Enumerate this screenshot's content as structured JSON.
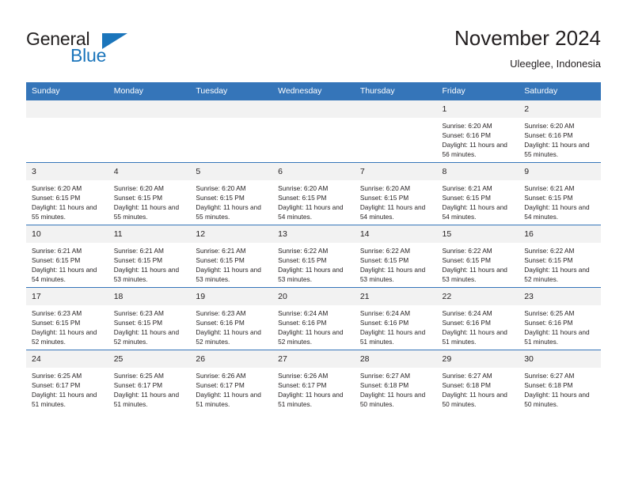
{
  "brand": {
    "name_part1": "General",
    "name_part2": "Blue"
  },
  "header": {
    "month_title": "November 2024",
    "location": "Uleeglee, Indonesia",
    "accent_color": "#3575b9",
    "daynum_strip_color": "#f2f2f2"
  },
  "weekdays": [
    "Sunday",
    "Monday",
    "Tuesday",
    "Wednesday",
    "Thursday",
    "Friday",
    "Saturday"
  ],
  "weeks": [
    [
      {
        "day": "",
        "sunrise": "",
        "sunset": "",
        "daylight": "",
        "empty": true
      },
      {
        "day": "",
        "sunrise": "",
        "sunset": "",
        "daylight": "",
        "empty": true
      },
      {
        "day": "",
        "sunrise": "",
        "sunset": "",
        "daylight": "",
        "empty": true
      },
      {
        "day": "",
        "sunrise": "",
        "sunset": "",
        "daylight": "",
        "empty": true
      },
      {
        "day": "",
        "sunrise": "",
        "sunset": "",
        "daylight": "",
        "empty": true
      },
      {
        "day": "1",
        "sunrise": "Sunrise: 6:20 AM",
        "sunset": "Sunset: 6:16 PM",
        "daylight": "Daylight: 11 hours and 56 minutes.",
        "empty": false
      },
      {
        "day": "2",
        "sunrise": "Sunrise: 6:20 AM",
        "sunset": "Sunset: 6:16 PM",
        "daylight": "Daylight: 11 hours and 55 minutes.",
        "empty": false
      }
    ],
    [
      {
        "day": "3",
        "sunrise": "Sunrise: 6:20 AM",
        "sunset": "Sunset: 6:15 PM",
        "daylight": "Daylight: 11 hours and 55 minutes.",
        "empty": false
      },
      {
        "day": "4",
        "sunrise": "Sunrise: 6:20 AM",
        "sunset": "Sunset: 6:15 PM",
        "daylight": "Daylight: 11 hours and 55 minutes.",
        "empty": false
      },
      {
        "day": "5",
        "sunrise": "Sunrise: 6:20 AM",
        "sunset": "Sunset: 6:15 PM",
        "daylight": "Daylight: 11 hours and 55 minutes.",
        "empty": false
      },
      {
        "day": "6",
        "sunrise": "Sunrise: 6:20 AM",
        "sunset": "Sunset: 6:15 PM",
        "daylight": "Daylight: 11 hours and 54 minutes.",
        "empty": false
      },
      {
        "day": "7",
        "sunrise": "Sunrise: 6:20 AM",
        "sunset": "Sunset: 6:15 PM",
        "daylight": "Daylight: 11 hours and 54 minutes.",
        "empty": false
      },
      {
        "day": "8",
        "sunrise": "Sunrise: 6:21 AM",
        "sunset": "Sunset: 6:15 PM",
        "daylight": "Daylight: 11 hours and 54 minutes.",
        "empty": false
      },
      {
        "day": "9",
        "sunrise": "Sunrise: 6:21 AM",
        "sunset": "Sunset: 6:15 PM",
        "daylight": "Daylight: 11 hours and 54 minutes.",
        "empty": false
      }
    ],
    [
      {
        "day": "10",
        "sunrise": "Sunrise: 6:21 AM",
        "sunset": "Sunset: 6:15 PM",
        "daylight": "Daylight: 11 hours and 54 minutes.",
        "empty": false
      },
      {
        "day": "11",
        "sunrise": "Sunrise: 6:21 AM",
        "sunset": "Sunset: 6:15 PM",
        "daylight": "Daylight: 11 hours and 53 minutes.",
        "empty": false
      },
      {
        "day": "12",
        "sunrise": "Sunrise: 6:21 AM",
        "sunset": "Sunset: 6:15 PM",
        "daylight": "Daylight: 11 hours and 53 minutes.",
        "empty": false
      },
      {
        "day": "13",
        "sunrise": "Sunrise: 6:22 AM",
        "sunset": "Sunset: 6:15 PM",
        "daylight": "Daylight: 11 hours and 53 minutes.",
        "empty": false
      },
      {
        "day": "14",
        "sunrise": "Sunrise: 6:22 AM",
        "sunset": "Sunset: 6:15 PM",
        "daylight": "Daylight: 11 hours and 53 minutes.",
        "empty": false
      },
      {
        "day": "15",
        "sunrise": "Sunrise: 6:22 AM",
        "sunset": "Sunset: 6:15 PM",
        "daylight": "Daylight: 11 hours and 53 minutes.",
        "empty": false
      },
      {
        "day": "16",
        "sunrise": "Sunrise: 6:22 AM",
        "sunset": "Sunset: 6:15 PM",
        "daylight": "Daylight: 11 hours and 52 minutes.",
        "empty": false
      }
    ],
    [
      {
        "day": "17",
        "sunrise": "Sunrise: 6:23 AM",
        "sunset": "Sunset: 6:15 PM",
        "daylight": "Daylight: 11 hours and 52 minutes.",
        "empty": false
      },
      {
        "day": "18",
        "sunrise": "Sunrise: 6:23 AM",
        "sunset": "Sunset: 6:15 PM",
        "daylight": "Daylight: 11 hours and 52 minutes.",
        "empty": false
      },
      {
        "day": "19",
        "sunrise": "Sunrise: 6:23 AM",
        "sunset": "Sunset: 6:16 PM",
        "daylight": "Daylight: 11 hours and 52 minutes.",
        "empty": false
      },
      {
        "day": "20",
        "sunrise": "Sunrise: 6:24 AM",
        "sunset": "Sunset: 6:16 PM",
        "daylight": "Daylight: 11 hours and 52 minutes.",
        "empty": false
      },
      {
        "day": "21",
        "sunrise": "Sunrise: 6:24 AM",
        "sunset": "Sunset: 6:16 PM",
        "daylight": "Daylight: 11 hours and 51 minutes.",
        "empty": false
      },
      {
        "day": "22",
        "sunrise": "Sunrise: 6:24 AM",
        "sunset": "Sunset: 6:16 PM",
        "daylight": "Daylight: 11 hours and 51 minutes.",
        "empty": false
      },
      {
        "day": "23",
        "sunrise": "Sunrise: 6:25 AM",
        "sunset": "Sunset: 6:16 PM",
        "daylight": "Daylight: 11 hours and 51 minutes.",
        "empty": false
      }
    ],
    [
      {
        "day": "24",
        "sunrise": "Sunrise: 6:25 AM",
        "sunset": "Sunset: 6:17 PM",
        "daylight": "Daylight: 11 hours and 51 minutes.",
        "empty": false
      },
      {
        "day": "25",
        "sunrise": "Sunrise: 6:25 AM",
        "sunset": "Sunset: 6:17 PM",
        "daylight": "Daylight: 11 hours and 51 minutes.",
        "empty": false
      },
      {
        "day": "26",
        "sunrise": "Sunrise: 6:26 AM",
        "sunset": "Sunset: 6:17 PM",
        "daylight": "Daylight: 11 hours and 51 minutes.",
        "empty": false
      },
      {
        "day": "27",
        "sunrise": "Sunrise: 6:26 AM",
        "sunset": "Sunset: 6:17 PM",
        "daylight": "Daylight: 11 hours and 51 minutes.",
        "empty": false
      },
      {
        "day": "28",
        "sunrise": "Sunrise: 6:27 AM",
        "sunset": "Sunset: 6:18 PM",
        "daylight": "Daylight: 11 hours and 50 minutes.",
        "empty": false
      },
      {
        "day": "29",
        "sunrise": "Sunrise: 6:27 AM",
        "sunset": "Sunset: 6:18 PM",
        "daylight": "Daylight: 11 hours and 50 minutes.",
        "empty": false
      },
      {
        "day": "30",
        "sunrise": "Sunrise: 6:27 AM",
        "sunset": "Sunset: 6:18 PM",
        "daylight": "Daylight: 11 hours and 50 minutes.",
        "empty": false
      }
    ]
  ]
}
